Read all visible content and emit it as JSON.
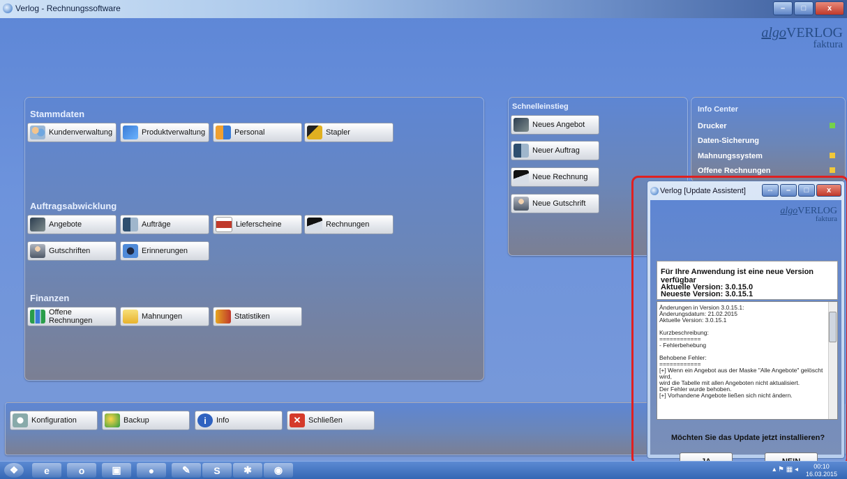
{
  "window": {
    "title": "Verlog - Rechnungssoftware"
  },
  "brand": {
    "algo": "algo",
    "verlog": "VERLOG",
    "faktura": "faktura"
  },
  "stammdaten": {
    "title": "Stammdaten",
    "buttons": [
      "Kundenverwaltung",
      "Produktverwaltung",
      "Personal",
      "Stapler"
    ]
  },
  "auftragsabwicklung": {
    "title": "Auftragsabwicklung",
    "buttons": [
      "Angebote",
      "Aufträge",
      "Lieferscheine",
      "Rechnungen",
      "Gutschriften",
      "Erinnerungen"
    ]
  },
  "finanzen": {
    "title": "Finanzen",
    "buttons": [
      "Offene Rechnungen",
      "Mahnungen",
      "Statistiken"
    ]
  },
  "schnelleinstieg": {
    "title": "Schnelleinstieg",
    "buttons": [
      "Neues Angebot",
      "Neuer Auftrag",
      "Neue Rechnung",
      "Neue Gutschrift"
    ]
  },
  "infocenter": {
    "title": "Info Center",
    "items": [
      "Drucker",
      "Daten-Sicherung",
      "Mahnungssystem",
      "Offene Rechnungen"
    ]
  },
  "bottom_bar": {
    "buttons": [
      "Konfiguration",
      "Backup",
      "Info",
      "Schließen"
    ]
  },
  "dialog": {
    "title": "Verlog [Update Assistent]",
    "notice": "Für Ihre Anwendung ist eine neue Version verfügbar",
    "current_version": "Aktuelle Version: 3.0.15.0",
    "latest_version": "Neueste Version: 3.0.15.1",
    "changelog": [
      "Änderungen in Version 3.0.15.1:",
      "Änderungsdatum:   21.02.2015",
      "Aktuelle Version:    3.0.15.1",
      "",
      "Kurzbeschreibung:",
      "============",
      "- Fehlerbehebung",
      "",
      "Behobene Fehler:",
      "============",
      "[+] Wenn ein Angebot aus der Maske \"Alle Angebote\" gelöscht wird,",
      "     wird die Tabelle mit allen Angeboten nicht aktualisiert.",
      "     Der Fehler wurde behoben.",
      "[+] Vorhandene Angebote ließen sich nicht ändern."
    ],
    "question": "Möchten Sie das Update jetzt installieren?",
    "yes": "JA",
    "no": "NEIN"
  },
  "taskbar": {
    "time": "00:10",
    "date": "16.03.2015"
  },
  "colors": {
    "highlight": "#e02020",
    "background": "#6d93dc"
  }
}
